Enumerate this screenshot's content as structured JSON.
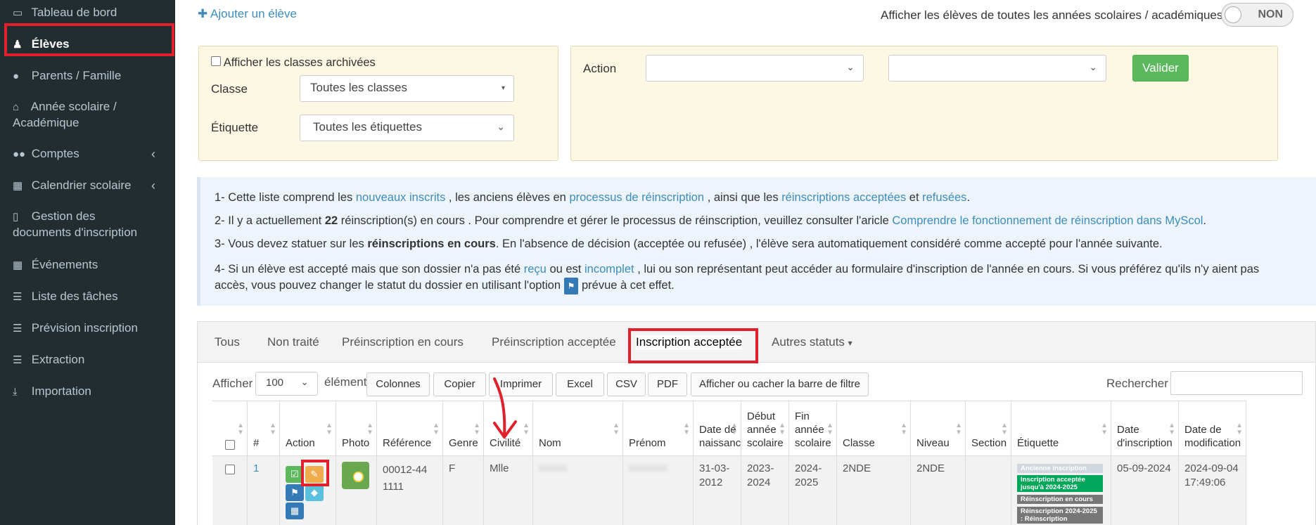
{
  "sidebar": {
    "items": [
      {
        "icon": "laptop-icon",
        "glyph": "💻",
        "label": "Tableau de bord"
      },
      {
        "icon": "graduate-icon",
        "glyph": "🎓",
        "label": "Élèves"
      },
      {
        "icon": "user-icon",
        "glyph": "👤",
        "label": "Parents / Famille"
      },
      {
        "icon": "home-icon",
        "glyph": "🏛",
        "label": "Année scolaire / Académique"
      },
      {
        "icon": "users-icon",
        "glyph": "👥",
        "label": "Comptes"
      },
      {
        "icon": "calendar-icon",
        "glyph": "📅",
        "label": "Calendrier scolaire"
      },
      {
        "icon": "file-icon",
        "glyph": "📄",
        "label": "Gestion des documents d'inscription"
      },
      {
        "icon": "calendar-icon",
        "glyph": "📅",
        "label": "Événements"
      },
      {
        "icon": "list-icon",
        "glyph": "☰",
        "label": "Liste des tâches"
      },
      {
        "icon": "list-icon",
        "glyph": "☰",
        "label": "Prévision inscription"
      },
      {
        "icon": "list-icon",
        "glyph": "☰",
        "label": "Extraction"
      },
      {
        "icon": "download-icon",
        "glyph": "⤓",
        "label": "Importation"
      }
    ]
  },
  "header": {
    "add_student": "Ajouter un élève",
    "toggle_label": "Afficher les élèves de toutes les années scolaires / académiques",
    "toggle_value": "NON"
  },
  "filters": {
    "archived_label": "Afficher les classes archivées",
    "class_label": "Classe",
    "class_value": "Toutes les classes",
    "tag_label": "Étiquette",
    "tag_value": "Toutes les étiquettes"
  },
  "action_panel": {
    "action_label": "Action",
    "select1_value": "",
    "select2_value": "",
    "validate_label": "Valider"
  },
  "info": {
    "line1": {
      "a": "1- Cette liste comprend les ",
      "b": "nouveaux inscrits",
      "c": " , les anciens élèves en ",
      "d": "processus de réinscription",
      "e": " , ainsi que les ",
      "f": "réinscriptions acceptées",
      "g": " et ",
      "h": "refusées",
      "i": "."
    },
    "line2": {
      "a": "2- Il y a actuellement ",
      "b": "22",
      "c": " réinscription(s) en cours . Pour comprendre et gérer le processus de réinscription, veuillez consulter l'aricle ",
      "d": "Comprendre le fonctionnement de réinscription dans MyScol",
      "e": "."
    },
    "line3": {
      "a": "3- Vous devez statuer sur les ",
      "b": "réinscriptions en cours",
      "c": ". En l'absence de décision (acceptée ou refusée) , l'élève sera automatiquement considéré comme accepté pour l'année suivante."
    },
    "line4": {
      "a": "4- Si un élève est accepté mais que son dossier n'a pas été ",
      "b": "reçu",
      "c": " ou est ",
      "d": "incomplet",
      "e": " , lui ou son représentant peut accéder au formulaire d'inscription de l'année en cours. Si vous préférez qu'ils n'y aient pas",
      "f": "accès, vous pouvez changer le statut du dossier en utilisant l'option ",
      "g": "⚑",
      "h": " prévue à cet effet."
    }
  },
  "tabs": [
    "Tous",
    "Non traité",
    "Préinscription en cours",
    "Préinscription acceptée",
    "Inscription acceptée",
    "Autres statuts"
  ],
  "active_tab": "Inscription acceptée",
  "toolbar": {
    "show_label": "Afficher",
    "page_size": "100",
    "elements_label": "éléments",
    "buttons": [
      "Colonnes",
      "Copier",
      "Imprimer",
      "Excel",
      "CSV",
      "PDF",
      "Afficher ou cacher la barre de filtre"
    ],
    "search_label": "Rechercher :"
  },
  "table": {
    "columns": [
      "#",
      "Action",
      "Photo",
      "Référence",
      "Genre",
      "Civilité",
      "Nom",
      "Prénom",
      "Date de naissance",
      "Début année scolaire",
      "Fin année scolaire",
      "Classe",
      "Niveau",
      "Section",
      "Étiquette",
      "Date d'inscription",
      "Date de modification"
    ],
    "rows": [
      {
        "num": "1",
        "reference": "00012-44 1111",
        "genre": "F",
        "civilite": "Mlle",
        "nom": "",
        "prenom": "",
        "date_naissance": "31-03-2012",
        "debut": "2023-2024",
        "fin": "2024-2025",
        "classe": "2NDE",
        "niveau": "2NDE",
        "section": "",
        "etiquettes": [
          {
            "text": "Ancienne inscription",
            "color": "#d2d6de"
          },
          {
            "text": "Inscription acceptée jusqu'à 2024-2025",
            "color": "#00a65a"
          },
          {
            "text": "Réinscription en cours",
            "color": "#777777"
          },
          {
            "text": "Réinscription 2024-2025 : Réinscription",
            "color": "#777777"
          }
        ],
        "date_inscription": "05-09-2024",
        "date_modification": "2024-09-04 17:49:06"
      }
    ]
  }
}
